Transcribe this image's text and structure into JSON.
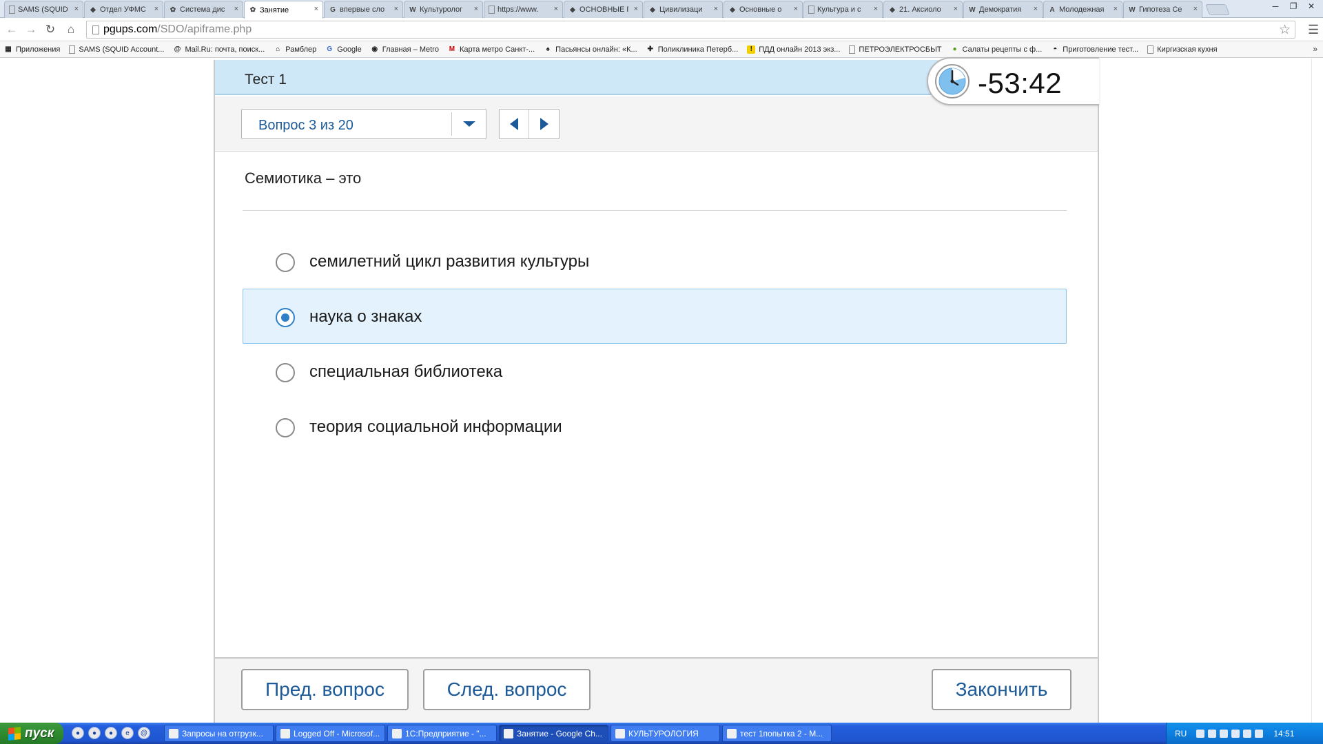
{
  "browser": {
    "tabs": [
      {
        "title": "SAMS (SQUID",
        "icon": "page-icon",
        "active": false
      },
      {
        "title": "Отдел УФМС",
        "icon": "site-icon",
        "active": false
      },
      {
        "title": "Система дис",
        "icon": "sdo-icon",
        "active": false
      },
      {
        "title": "Занятие",
        "icon": "sdo-icon",
        "active": true
      },
      {
        "title": "впервые сло",
        "icon": "google-icon",
        "active": false
      },
      {
        "title": "Культуролог",
        "icon": "wikipedia-icon",
        "active": false
      },
      {
        "title": "https://www.",
        "icon": "page-icon",
        "active": false
      },
      {
        "title": "ОСНОВНЫЕ П",
        "icon": "site-icon",
        "active": false
      },
      {
        "title": "Цивилизаци",
        "icon": "site-icon",
        "active": false
      },
      {
        "title": "Основные о",
        "icon": "site-icon",
        "active": false
      },
      {
        "title": "Культура и с",
        "icon": "page-icon",
        "active": false
      },
      {
        "title": "21. Аксиоло",
        "icon": "site-icon",
        "active": false
      },
      {
        "title": "Демократия",
        "icon": "wikipedia-icon",
        "active": false
      },
      {
        "title": "Молодежная",
        "icon": "a-icon",
        "active": false
      },
      {
        "title": "Гипотеза Се",
        "icon": "wikipedia-icon",
        "active": false
      }
    ],
    "tab_close_glyph": "×",
    "url_host": "pgups.com",
    "url_path": "/SDO/apiframe.php",
    "bookmarks": [
      {
        "label": "Приложения",
        "icon": "apps-icon"
      },
      {
        "label": "SAMS (SQUID Account...",
        "icon": "page-icon"
      },
      {
        "label": "Mail.Ru: почта, поиск...",
        "icon": "mail-icon"
      },
      {
        "label": "Рамблер",
        "icon": "home-icon"
      },
      {
        "label": "Google",
        "icon": "google-icon"
      },
      {
        "label": "Главная – Metro",
        "icon": "metro-icon"
      },
      {
        "label": "Карта метро Санкт-...",
        "icon": "metro-m-icon"
      },
      {
        "label": "Пасьянсы онлайн: «К...",
        "icon": "spade-icon"
      },
      {
        "label": "Поликлиника Петерб...",
        "icon": "clinic-icon"
      },
      {
        "label": "ПДД онлайн 2013 экз...",
        "icon": "warning-icon"
      },
      {
        "label": "ПЕТРОЭЛЕКТРОСБЫТ",
        "icon": "page-icon"
      },
      {
        "label": "Салаты рецепты с ф...",
        "icon": "leaf-icon"
      },
      {
        "label": "Приготовление тест...",
        "icon": "chef-icon"
      },
      {
        "label": "Киргизская кухня",
        "icon": "page-icon"
      }
    ]
  },
  "test": {
    "title": "Тест 1",
    "question_selector": "Вопрос 3 из 20",
    "timer": "-53:42",
    "question": "Семиотика – это",
    "answers": [
      {
        "text": "семилетний цикл развития культуры",
        "selected": false
      },
      {
        "text": "наука о знаках",
        "selected": true
      },
      {
        "text": "специальная библиотека",
        "selected": false
      },
      {
        "text": "теория социальной информации",
        "selected": false
      }
    ],
    "buttons": {
      "prev": "Пред. вопрос",
      "next": "След. вопрос",
      "finish": "Закончить"
    },
    "accent_color": "#1c5a99",
    "selected_bg": "#e3f2fc"
  },
  "taskbar": {
    "start_label": "пуск",
    "tasks": [
      {
        "label": "Запросы на отгрузк...",
        "active": false
      },
      {
        "label": "Logged Off - Microsof...",
        "active": false
      },
      {
        "label": "1С:Предприятие - \"...",
        "active": false
      },
      {
        "label": "Занятие - Google Ch...",
        "active": true
      },
      {
        "label": "КУЛЬТУРОЛОГИЯ",
        "active": false
      },
      {
        "label": "тест 1попытка 2 - M...",
        "active": false
      }
    ],
    "language": "RU",
    "clock": "14:51"
  }
}
